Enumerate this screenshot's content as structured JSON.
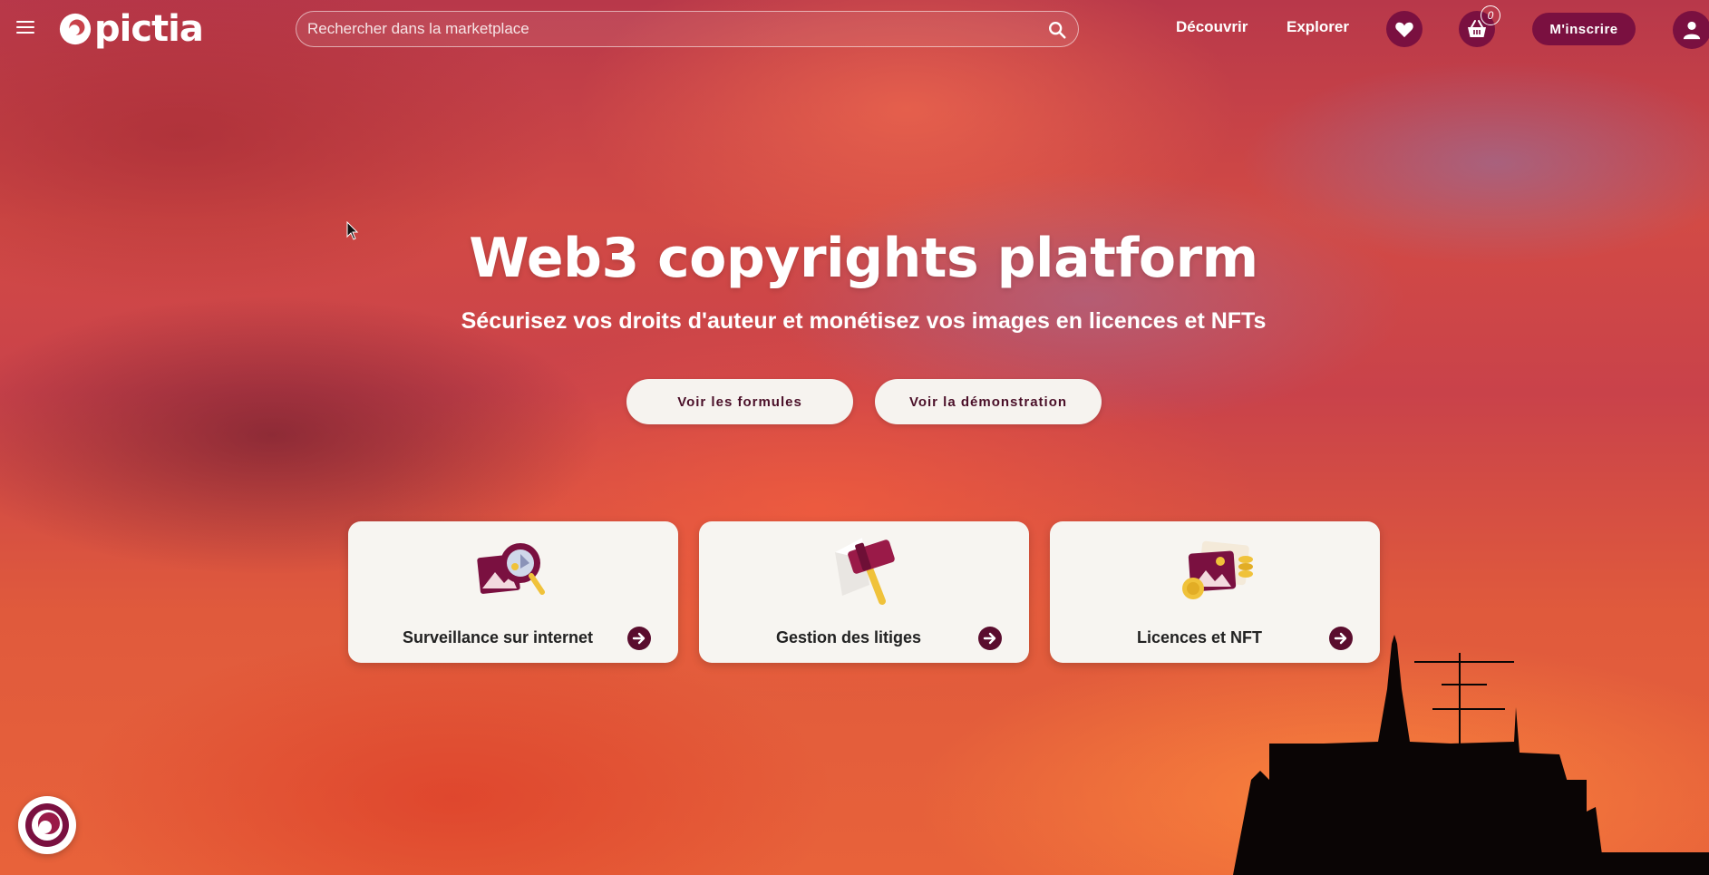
{
  "header": {
    "brand": "pictia",
    "search_placeholder": "Rechercher dans la marketplace",
    "nav": {
      "discover": "Découvrir",
      "explore": "Explorer"
    },
    "cart_count": "0",
    "signup_label": "M'inscrire",
    "icons": [
      "menu-icon",
      "search-icon",
      "heart-icon",
      "basket-icon",
      "user-icon"
    ]
  },
  "hero": {
    "title": "Web3 copyrights platform",
    "subtitle": "Sécurisez vos droits d'auteur et monétisez vos images en licences et NFTs",
    "buttons": {
      "plans": "Voir les formules",
      "demo": "Voir la démonstration"
    }
  },
  "features": [
    {
      "label": "Surveillance sur internet",
      "icon": "magnifier-image-icon"
    },
    {
      "label": "Gestion des litiges",
      "icon": "gavel-icon"
    },
    {
      "label": "Licences et NFT",
      "icon": "image-coins-icon"
    }
  ],
  "colors": {
    "brand": "#7a1040",
    "brand_dark": "#5a0d2e",
    "card_bg": "#f7f5f1",
    "accent_gold": "#f0c23a"
  }
}
